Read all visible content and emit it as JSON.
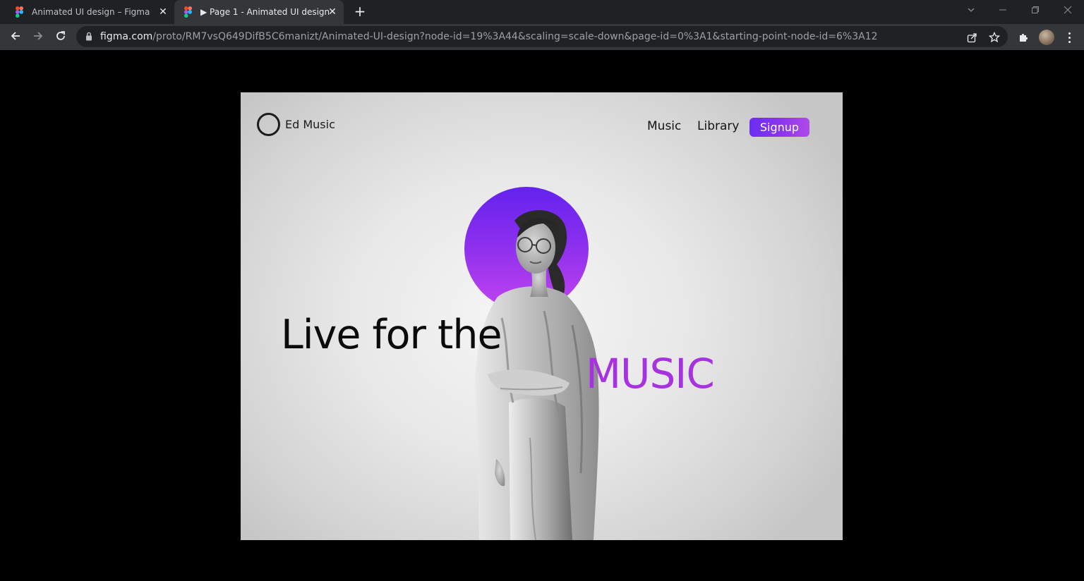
{
  "browser": {
    "tabs": [
      {
        "title": "Animated UI design – Figma",
        "active": false
      },
      {
        "title": "▶ Page 1 - Animated UI design",
        "active": true
      }
    ],
    "new_tab_symbol": "+",
    "url_host": "figma.com",
    "url_path": "/proto/RM7vsQ649DifB5C6manizt/Animated-UI-design?node-id=19%3A44&scaling=scale-down&page-id=0%3A1&starting-point-node-id=6%3A12",
    "icons": {
      "favicon": "figma-icon",
      "back": "arrow-left-icon",
      "forward": "arrow-right-icon",
      "reload": "reload-icon",
      "lock": "lock-icon",
      "share": "share-icon",
      "bookmark": "star-icon",
      "extensions": "puzzle-icon",
      "menu": "kebab-menu-icon"
    }
  },
  "site": {
    "brand": "Ed Music",
    "nav": [
      "Music",
      "Library"
    ],
    "signup_label": "Signup",
    "headline": "Live for the",
    "highlight": "MUSIC",
    "colors": {
      "accent_start": "#6a2df0",
      "accent_end": "#b04ae8",
      "highlight_text": "#a632e0",
      "headline_text": "#0b0b0b"
    }
  }
}
